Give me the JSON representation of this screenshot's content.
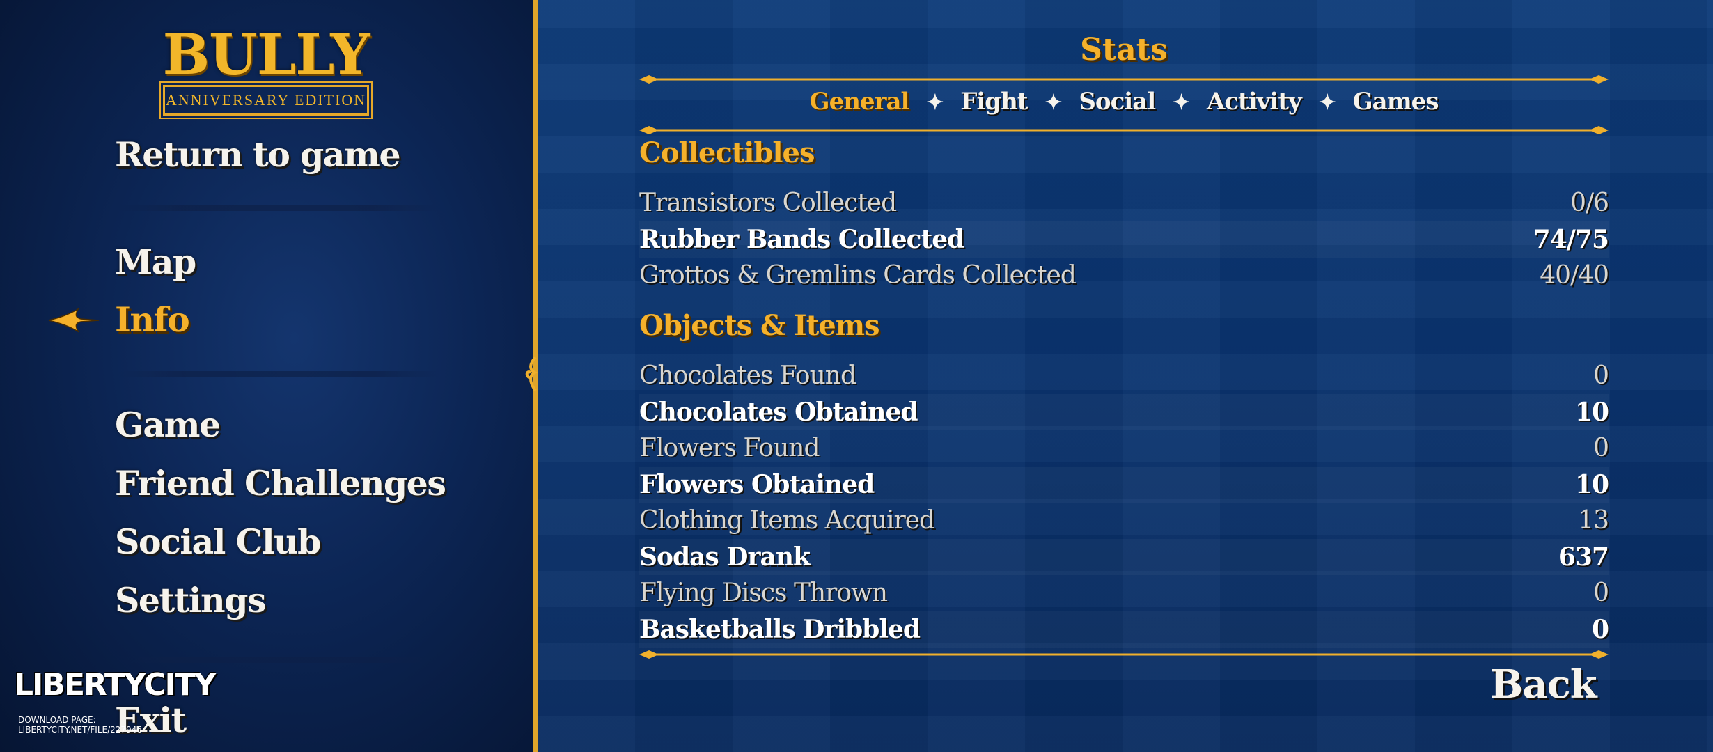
{
  "logo": {
    "title": "BULLY",
    "subtitle": "ANNIVERSARY EDITION"
  },
  "menu": {
    "items": [
      {
        "label": "Return to game"
      },
      {
        "label": "Map"
      },
      {
        "label": "Info",
        "selected": true
      },
      {
        "label": "Game"
      },
      {
        "label": "Friend Challenges"
      },
      {
        "label": "Social Club"
      },
      {
        "label": "Settings"
      },
      {
        "label": "Exit"
      }
    ]
  },
  "watermark": {
    "logo_text": "LIBERTYCITY",
    "line1": "DOWNLOAD PAGE:",
    "line2": "LIBERTYCITY.NET/FILE/227946"
  },
  "stats": {
    "title": "Stats",
    "tabs": [
      {
        "label": "General",
        "active": true
      },
      {
        "label": "Fight"
      },
      {
        "label": "Social"
      },
      {
        "label": "Activity"
      },
      {
        "label": "Games"
      }
    ],
    "sections": [
      {
        "heading": "Collectibles",
        "rows": [
          {
            "label": "Transistors Collected",
            "value": "0/6"
          },
          {
            "label": "Rubber Bands Collected",
            "value": "74/75"
          },
          {
            "label": "Grottos & Gremlins Cards Collected",
            "value": "40/40"
          }
        ]
      },
      {
        "heading": "Objects & Items",
        "rows": [
          {
            "label": "Chocolates Found",
            "value": "0"
          },
          {
            "label": "Chocolates Obtained",
            "value": "10"
          },
          {
            "label": "Flowers Found",
            "value": "0"
          },
          {
            "label": "Flowers Obtained",
            "value": "10"
          },
          {
            "label": "Clothing Items Acquired",
            "value": "13"
          },
          {
            "label": "Sodas Drank",
            "value": "637"
          },
          {
            "label": "Flying Discs Thrown",
            "value": "0"
          },
          {
            "label": "Basketballs Dribbled",
            "value": "0"
          }
        ]
      }
    ],
    "back_label": "Back",
    "tab_separator": "✦"
  },
  "colors": {
    "accent_gold": "#f5b12b",
    "text_white": "#f6f3ec",
    "panel_blue": "#0a3470",
    "menu_blue": "#0c2554"
  }
}
